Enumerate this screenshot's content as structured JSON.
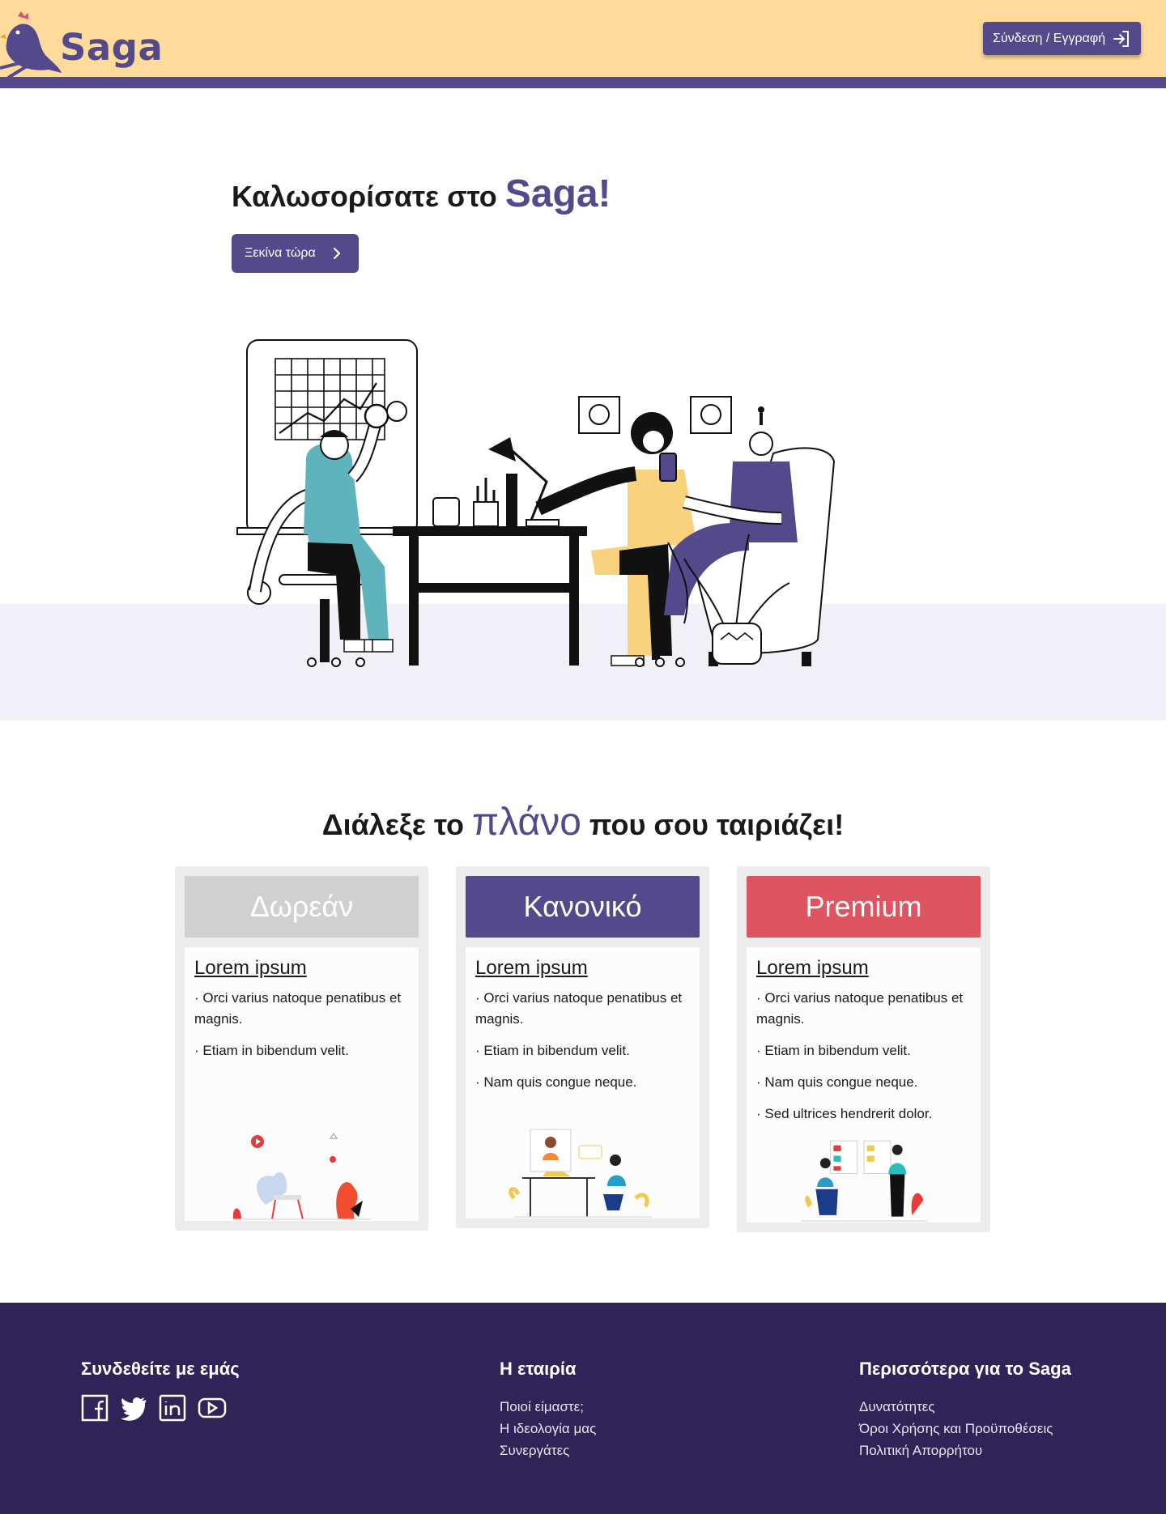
{
  "header": {
    "brand": "Saga",
    "login_label": "Σύνδεση / Εγγραφή",
    "login_icon": "login-arrow-icon"
  },
  "hero": {
    "title_prefix": "Καλωσορίσατε στο",
    "title_brand": "Saga!",
    "cta_label": "Ξεκίνα τώρα",
    "cta_icon": "chevron-right-icon"
  },
  "plans": {
    "title_prefix": "Διάλεξε το",
    "title_accent": "πλάνο",
    "title_suffix": "που σου ταιριάζει!",
    "cards": [
      {
        "name": "Δωρεάν",
        "color": "#d0d0d0",
        "subtitle": "Lorem ipsum",
        "items": [
          "· Orci varius natoque penatibus et magnis.",
          "· Etiam in bibendum velit."
        ]
      },
      {
        "name": "Κανονικό",
        "color": "#544a8b",
        "subtitle": "Lorem ipsum",
        "items": [
          "· Orci varius natoque penatibus et magnis.",
          "· Etiam in bibendum velit.",
          "· Nam quis congue neque."
        ]
      },
      {
        "name": "Premium",
        "color": "#dc5561",
        "subtitle": "Lorem ipsum",
        "items": [
          "· Orci varius natoque penatibus et magnis.",
          "· Etiam in bibendum velit.",
          "· Nam quis congue neque.",
          "· Sed ultrices hendrerit dolor."
        ]
      }
    ]
  },
  "footer": {
    "connect": {
      "title": "Συνδεθείτε με εμάς",
      "icons": [
        "facebook-icon",
        "twitter-icon",
        "linkedin-icon",
        "youtube-icon"
      ]
    },
    "company": {
      "title": "Η εταιρία",
      "links": [
        "Ποιοί είμαστε;",
        "Η ιδεολογία μας",
        "Συνεργάτες"
      ]
    },
    "more": {
      "title": "Περισσότερα για το Saga",
      "links": [
        "Δυνατότητες",
        "Όροι Χρήσης και Προϋποθέσεις",
        "Πολιτική Απορρήτου"
      ]
    }
  },
  "colors": {
    "header_bg": "#fedb9b",
    "primary": "#544a8b",
    "footer_bg": "#2f2357",
    "premium": "#dc5561",
    "free": "#d0d0d0"
  }
}
